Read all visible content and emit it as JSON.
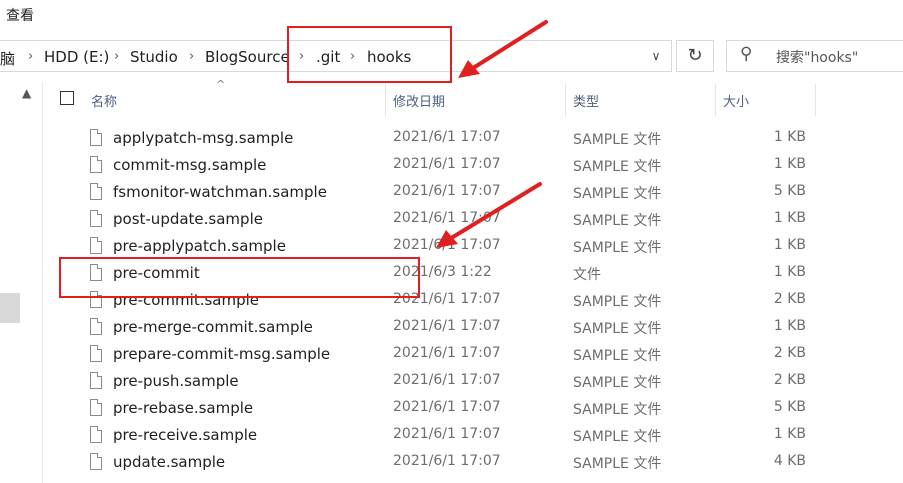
{
  "ribbon": {
    "view_tab": "查看"
  },
  "address": {
    "crumbs": [
      "脑",
      "HDD (E:)",
      "Studio",
      "BlogSource",
      ".git",
      "hooks"
    ],
    "separator": "›"
  },
  "search": {
    "placeholder": "搜索\"hooks\""
  },
  "columns": {
    "name": "名称",
    "date": "修改日期",
    "type": "类型",
    "size": "大小"
  },
  "files": [
    {
      "name": "applypatch-msg.sample",
      "date": "2021/6/1 17:07",
      "type": "SAMPLE 文件",
      "size": "1 KB"
    },
    {
      "name": "commit-msg.sample",
      "date": "2021/6/1 17:07",
      "type": "SAMPLE 文件",
      "size": "1 KB"
    },
    {
      "name": "fsmonitor-watchman.sample",
      "date": "2021/6/1 17:07",
      "type": "SAMPLE 文件",
      "size": "5 KB"
    },
    {
      "name": "post-update.sample",
      "date": "2021/6/1 17:07",
      "type": "SAMPLE 文件",
      "size": "1 KB"
    },
    {
      "name": "pre-applypatch.sample",
      "date": "2021/6/1 17:07",
      "type": "SAMPLE 文件",
      "size": "1 KB"
    },
    {
      "name": "pre-commit",
      "date": "2021/6/3 1:22",
      "type": "文件",
      "size": "1 KB"
    },
    {
      "name": "pre-commit.sample",
      "date": "2021/6/1 17:07",
      "type": "SAMPLE 文件",
      "size": "2 KB"
    },
    {
      "name": "pre-merge-commit.sample",
      "date": "2021/6/1 17:07",
      "type": "SAMPLE 文件",
      "size": "1 KB"
    },
    {
      "name": "prepare-commit-msg.sample",
      "date": "2021/6/1 17:07",
      "type": "SAMPLE 文件",
      "size": "2 KB"
    },
    {
      "name": "pre-push.sample",
      "date": "2021/6/1 17:07",
      "type": "SAMPLE 文件",
      "size": "2 KB"
    },
    {
      "name": "pre-rebase.sample",
      "date": "2021/6/1 17:07",
      "type": "SAMPLE 文件",
      "size": "5 KB"
    },
    {
      "name": "pre-receive.sample",
      "date": "2021/6/1 17:07",
      "type": "SAMPLE 文件",
      "size": "1 KB"
    },
    {
      "name": "update.sample",
      "date": "2021/6/1 17:07",
      "type": "SAMPLE 文件",
      "size": "4 KB"
    }
  ],
  "icons": {
    "refresh": "refresh-icon",
    "search": "search-icon",
    "file": "file-icon",
    "dropdown": "chevron-down-icon",
    "sort": "sort-ascending-icon"
  },
  "colors": {
    "annotation": "#e02020",
    "header_text": "#4c607a"
  }
}
